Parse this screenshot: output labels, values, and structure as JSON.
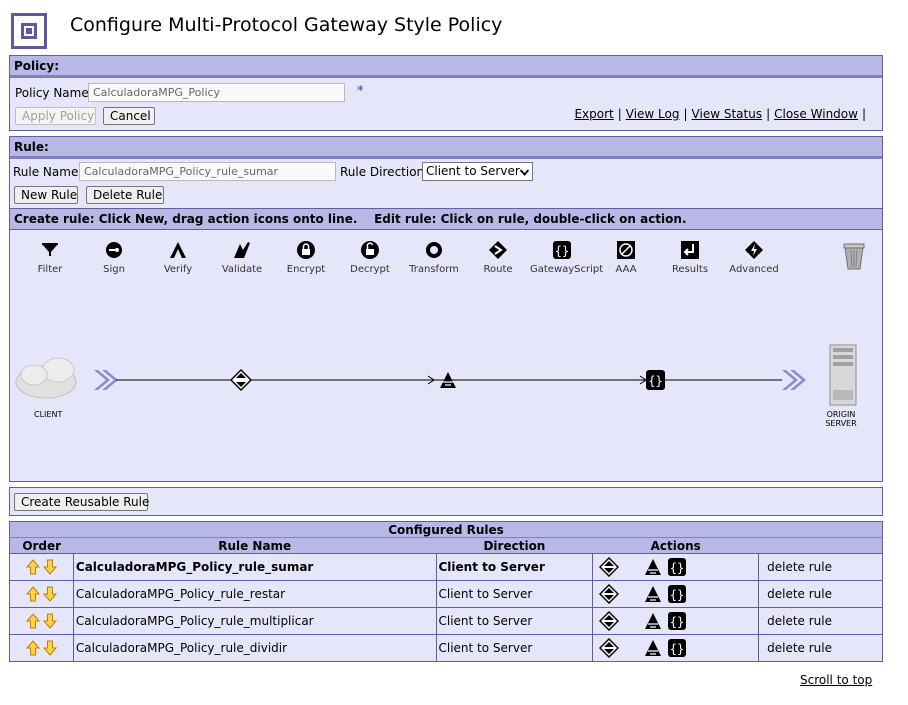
{
  "page_title": "Configure Multi-Protocol Gateway Style Policy",
  "policy": {
    "header": "Policy:",
    "name_label": "Policy Name:",
    "name_value": "CalculadoraMPG_Policy",
    "required_mark": "*",
    "apply_label": "Apply Policy",
    "cancel_label": "Cancel",
    "links": [
      "Export",
      "View Log",
      "View Status",
      "Close Window"
    ]
  },
  "rule": {
    "header": "Rule:",
    "name_label": "Rule Name:",
    "name_value": "CalculadoraMPG_Policy_rule_sumar",
    "direction_label": "Rule Direction:",
    "direction_value": "Client to Server",
    "new_label": "New Rule",
    "delete_label": "Delete Rule",
    "instructions": "Create rule: Click New, drag action icons onto line.    Edit rule: Click on rule, double-click on action."
  },
  "actions_palette": [
    {
      "label": "Filter",
      "icon": "filter-icon"
    },
    {
      "label": "Sign",
      "icon": "sign-icon"
    },
    {
      "label": "Verify",
      "icon": "verify-icon"
    },
    {
      "label": "Validate",
      "icon": "validate-icon"
    },
    {
      "label": "Encrypt",
      "icon": "encrypt-icon"
    },
    {
      "label": "Decrypt",
      "icon": "decrypt-icon"
    },
    {
      "label": "Transform",
      "icon": "transform-icon"
    },
    {
      "label": "Route",
      "icon": "route-icon"
    },
    {
      "label": "GatewayScript",
      "icon": "gatewayscript-icon"
    },
    {
      "label": "AAA",
      "icon": "aaa-icon"
    },
    {
      "label": "Results",
      "icon": "results-icon"
    },
    {
      "label": "Advanced",
      "icon": "advanced-icon"
    }
  ],
  "pipeline": {
    "client_label": "CLIENT",
    "server_label": "ORIGIN SERVER",
    "nodes": [
      "match-icon",
      "validate-icon",
      "gatewayscript-icon"
    ]
  },
  "create_reusable_label": "Create Reusable Rule",
  "configured_rules": {
    "caption": "Configured Rules",
    "headers": [
      "Order",
      "Rule Name",
      "Direction",
      "Actions"
    ],
    "rows": [
      {
        "name": "CalculadoraMPG_Policy_rule_sumar",
        "direction": "Client to Server",
        "delete": "delete rule"
      },
      {
        "name": "CalculadoraMPG_Policy_rule_restar",
        "direction": "Client to Server",
        "delete": "delete rule"
      },
      {
        "name": "CalculadoraMPG_Policy_rule_multiplicar",
        "direction": "Client to Server",
        "delete": "delete rule"
      },
      {
        "name": "CalculadoraMPG_Policy_rule_dividir",
        "direction": "Client to Server",
        "delete": "delete rule"
      }
    ]
  },
  "scroll_to_top": "Scroll to top",
  "colors": {
    "panel_bg": "#e6e6fa",
    "header_bg": "#b8b8e6",
    "border": "#6060a0",
    "arrow_orange": "#f0a000"
  }
}
